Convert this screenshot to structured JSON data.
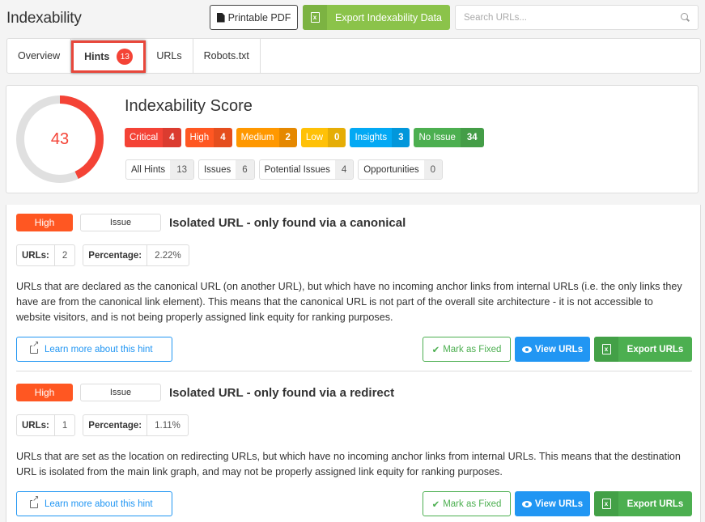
{
  "header": {
    "title": "Indexability",
    "pdf_button": "Printable PDF",
    "export_button": "Export Indexability Data",
    "search_placeholder": "Search URLs..."
  },
  "tabs": [
    {
      "label": "Overview",
      "active": false
    },
    {
      "label": "Hints",
      "active": true,
      "badge": "13"
    },
    {
      "label": "URLs",
      "active": false
    },
    {
      "label": "Robots.txt",
      "active": false
    }
  ],
  "score": {
    "title": "Indexability Score",
    "value": "43",
    "percent": 43,
    "colors": {
      "ring": "#f44336",
      "track": "#e0e0e0"
    },
    "severities": [
      {
        "label": "Critical",
        "count": "4",
        "color": "#f44336"
      },
      {
        "label": "High",
        "count": "4",
        "color": "#ff5722"
      },
      {
        "label": "Medium",
        "count": "2",
        "color": "#ff9800"
      },
      {
        "label": "Low",
        "count": "0",
        "color": "#ffc107"
      },
      {
        "label": "Insights",
        "count": "3",
        "color": "#03a9f4"
      },
      {
        "label": "No Issue",
        "count": "34",
        "color": "#4caf50"
      }
    ],
    "types": [
      {
        "label": "All Hints",
        "count": "13"
      },
      {
        "label": "Issues",
        "count": "6"
      },
      {
        "label": "Potential Issues",
        "count": "4"
      },
      {
        "label": "Opportunities",
        "count": "0"
      }
    ]
  },
  "hints": [
    {
      "severity": "High",
      "type": "Issue",
      "title": "Isolated URL - only found via a canonical",
      "urls_label": "URLs:",
      "urls": "2",
      "percentage_label": "Percentage:",
      "percentage": "2.22%",
      "description": "URLs that are declared as the canonical URL (on another URL), but which have no incoming anchor links from internal URLs (i.e. the only links they have are from the canonical link element). This means that the canonical URL is not part of the overall site architecture - it is not accessible to website visitors, and is not being properly assigned link equity for ranking purposes.",
      "learn_more": "Learn more about this hint",
      "mark_fixed": "Mark as Fixed",
      "view_urls": "View URLs",
      "export_urls": "Export URLs"
    },
    {
      "severity": "High",
      "type": "Issue",
      "title": "Isolated URL - only found via a redirect",
      "urls_label": "URLs:",
      "urls": "1",
      "percentage_label": "Percentage:",
      "percentage": "1.11%",
      "description": "URLs that are set as the location on redirecting URLs, but which have no incoming anchor links from internal URLs. This means that the destination URL is isolated from the main link graph, and may not be properly assigned link equity for ranking purposes.",
      "learn_more": "Learn more about this hint",
      "mark_fixed": "Mark as Fixed",
      "view_urls": "View URLs",
      "export_urls": "Export URLs"
    }
  ],
  "icons": {
    "pdf": "file-icon",
    "excel": "excel-file-icon",
    "search": "search-icon",
    "external": "external-link-icon",
    "check": "check-icon",
    "eye": "eye-icon"
  }
}
